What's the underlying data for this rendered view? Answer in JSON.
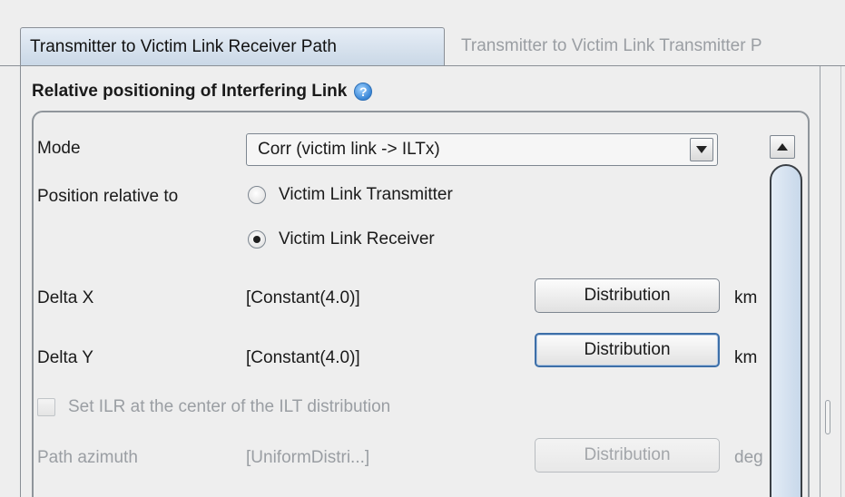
{
  "tabs": [
    {
      "label": "Transmitter to Victim Link Receiver Path",
      "active": true
    },
    {
      "label": "Transmitter to Victim Link Transmitter P",
      "active": false
    }
  ],
  "section": {
    "title": "Relative positioning of Interfering Link",
    "help_icon": "help-icon"
  },
  "mode": {
    "label": "Mode",
    "selected": "Corr (victim link -> ILTx)"
  },
  "position": {
    "label": "Position relative to",
    "options": [
      {
        "label": "Victim Link Transmitter",
        "selected": false
      },
      {
        "label": "Victim Link Receiver",
        "selected": true
      }
    ]
  },
  "delta_x": {
    "label": "Delta X",
    "value": "[Constant(4.0)]",
    "button": "Distribution",
    "unit": "km"
  },
  "delta_y": {
    "label": "Delta Y",
    "value": "[Constant(4.0)]",
    "button": "Distribution",
    "unit": "km"
  },
  "set_ilr": {
    "label": "Set ILR at the center of the ILT distribution",
    "checked": false,
    "enabled": false
  },
  "path_azimuth": {
    "label": "Path azimuth",
    "value": "[UniformDistri...]",
    "button": "Distribution",
    "unit": "deg",
    "enabled": false
  },
  "colors": {
    "tab_active_top": "#e7eef6",
    "tab_active_bottom": "#c9d7e6",
    "help_icon": "#3a86d6",
    "focus_border": "#3d6fa8",
    "disabled_text": "#9a9ea3"
  }
}
